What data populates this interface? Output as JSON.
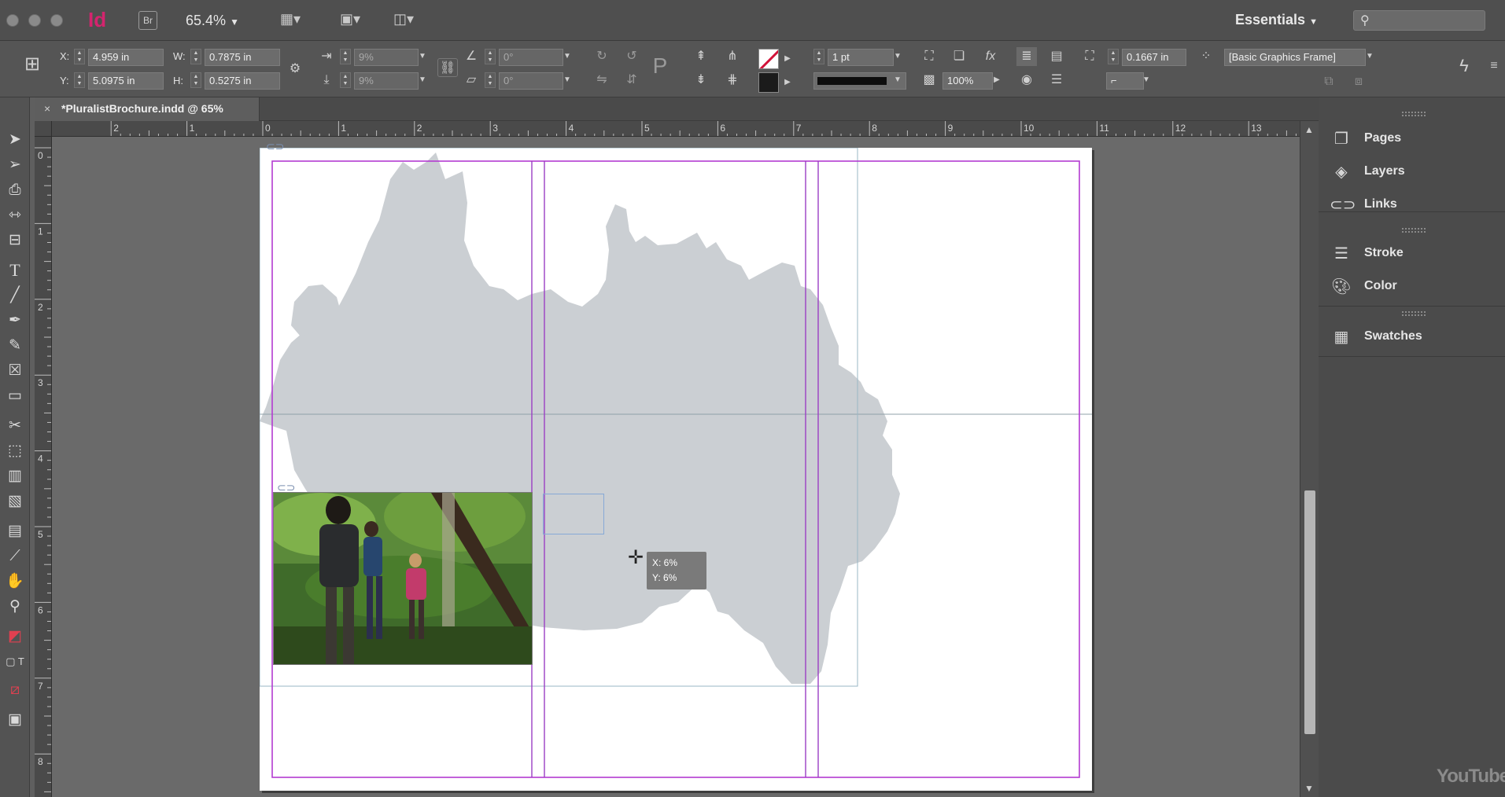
{
  "appbar": {
    "app_logo": "Id",
    "bridge_label": "Br",
    "zoom_level": "65.4%",
    "workspace": "Essentials",
    "search_placeholder": ""
  },
  "control_panel": {
    "x_label": "X:",
    "x_value": "4.959 in",
    "y_label": "Y:",
    "y_value": "5.0975 in",
    "w_label": "W:",
    "w_value": "0.7875 in",
    "h_label": "H:",
    "h_value": "0.5275 in",
    "scale_x": "9%",
    "scale_y": "9%",
    "rotate": "0°",
    "shear": "0°",
    "stroke_weight": "1 pt",
    "opacity": "100%",
    "fitting_offset": "0.1667 in",
    "object_style": "[Basic Graphics Frame]"
  },
  "document": {
    "tab_title": "*PluralistBrochure.indd @ 65%",
    "ruler_h_labels": [
      "2",
      "1",
      "0",
      "1",
      "2",
      "3",
      "4",
      "5",
      "6",
      "7",
      "8",
      "9",
      "10",
      "11",
      "12",
      "13"
    ],
    "ruler_v_labels": [
      "0",
      "1",
      "2",
      "3",
      "4",
      "5",
      "6",
      "7",
      "8"
    ],
    "tooltip_x": "X: 6%",
    "tooltip_y": "Y: 6%"
  },
  "dock": {
    "group1": [
      "Pages",
      "Layers",
      "Links"
    ],
    "group2": [
      "Stroke",
      "Color"
    ],
    "group3": [
      "Swatches"
    ]
  },
  "watermark": "YouTube",
  "colors": {
    "map_fill": "#cbcfd3",
    "margin_guide": "#b33bd1",
    "column_guide": "#9b3fc4",
    "bleed_frame": "#9ab7c5",
    "logo": "#d4246e"
  }
}
